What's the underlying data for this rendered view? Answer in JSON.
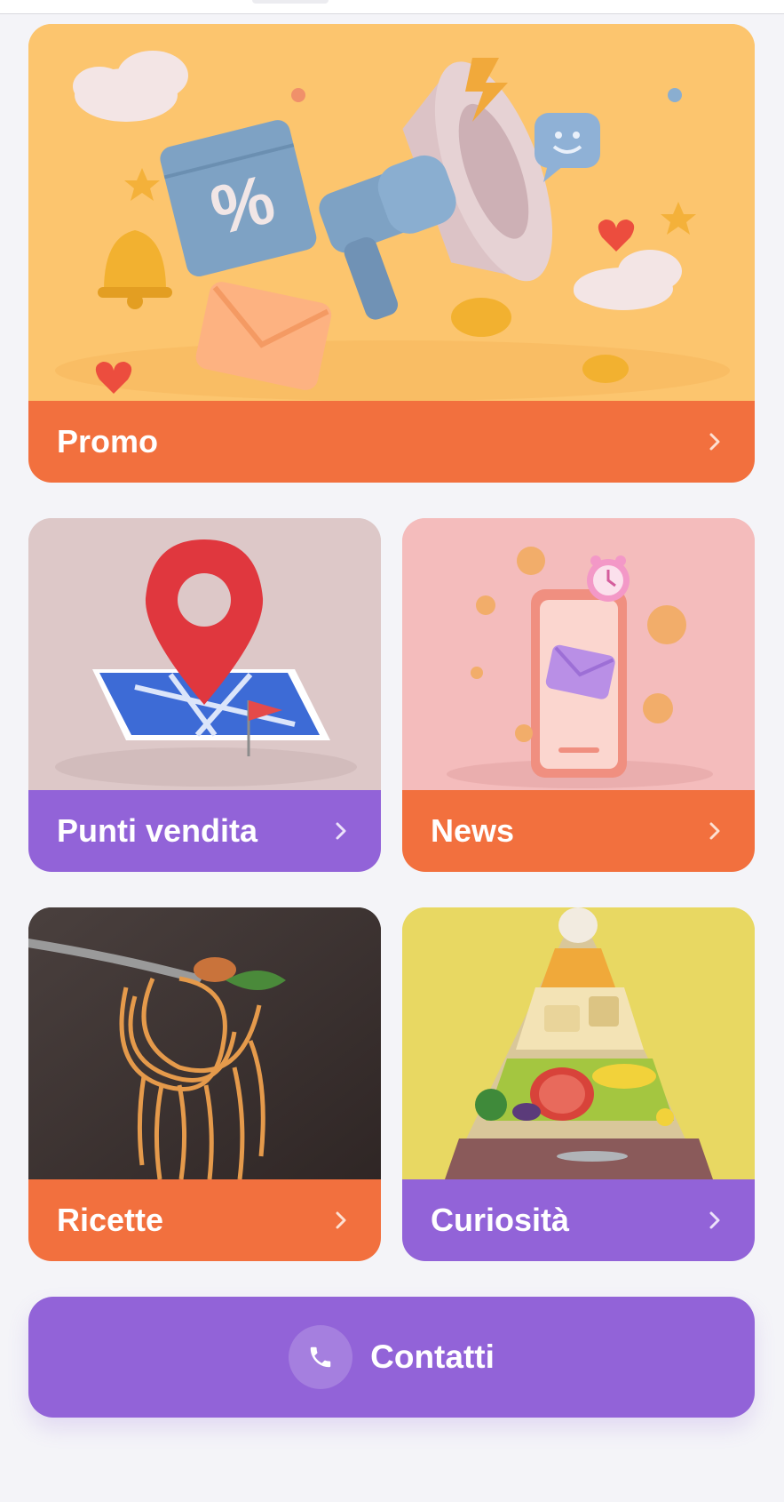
{
  "cards": [
    {
      "label": "Promo",
      "bar_color": "#f2703e",
      "image": "megaphone-promo-illustration"
    },
    {
      "label": "Punti vendita",
      "bar_color": "#9263d8",
      "image": "map-pin-illustration"
    },
    {
      "label": "News",
      "bar_color": "#f2703e",
      "image": "phone-news-illustration"
    },
    {
      "label": "Ricette",
      "bar_color": "#f2703e",
      "image": "spaghetti-fork-photo"
    },
    {
      "label": "Curiosità",
      "bar_color": "#9263d8",
      "image": "food-pyramid-photo"
    }
  ],
  "contact": {
    "label": "Contatti",
    "icon": "phone-icon",
    "color": "#9263d8"
  },
  "icons": {
    "chevron": "chevron-right-icon"
  },
  "colors": {
    "background": "#f4f4f8",
    "orange": "#f2703e",
    "purple": "#9263d8"
  }
}
